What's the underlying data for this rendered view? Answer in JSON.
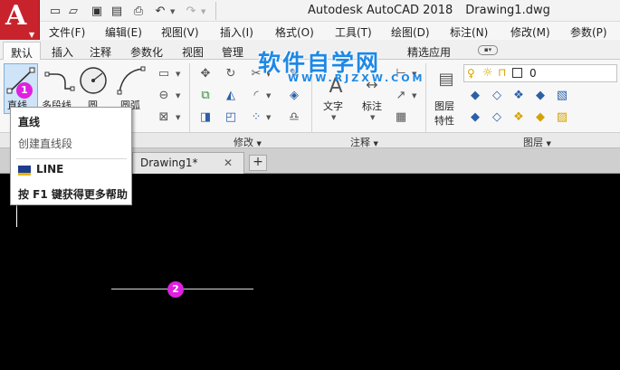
{
  "titlebar": {
    "app_name": "Autodesk AutoCAD 2018",
    "document": "Drawing1.dwg"
  },
  "menubar": {
    "items": [
      "文件(F)",
      "编辑(E)",
      "视图(V)",
      "插入(I)",
      "格式(O)",
      "工具(T)",
      "绘图(D)",
      "标注(N)",
      "修改(M)",
      "参数(P)"
    ]
  },
  "ribbon_tabs": {
    "items": [
      "默认",
      "插入",
      "注释",
      "参数化",
      "视图",
      "管理",
      "精选应用"
    ],
    "active": "默认"
  },
  "ribbon": {
    "draw": {
      "line": "直线",
      "polyline": "多段线",
      "circle": "圆",
      "arc": "圆弧"
    },
    "annotation": {
      "text": "文字",
      "dimension": "标注"
    },
    "layers": {
      "layer_properties_line1": "图层",
      "layer_properties_line2": "特性",
      "current_layer": "0"
    },
    "panel_titles": {
      "modify": "修改",
      "annotation": "注释",
      "layers": "图层"
    }
  },
  "watermark": {
    "title": "软件自学网",
    "url": "WWW.RJZXW.COM"
  },
  "tooltip": {
    "title": "直线",
    "description": "创建直线段",
    "command": "LINE",
    "help": "按 F1 键获得更多帮助"
  },
  "file_tabs": {
    "active": "Drawing1*",
    "close_glyph": "✕",
    "new_glyph": "+"
  },
  "markers": {
    "one": "1",
    "two": "2"
  },
  "colors": {
    "app_button": "#c8232c",
    "marker": "#e020e0",
    "watermark": "#1e88e5",
    "canvas": "#000000"
  }
}
